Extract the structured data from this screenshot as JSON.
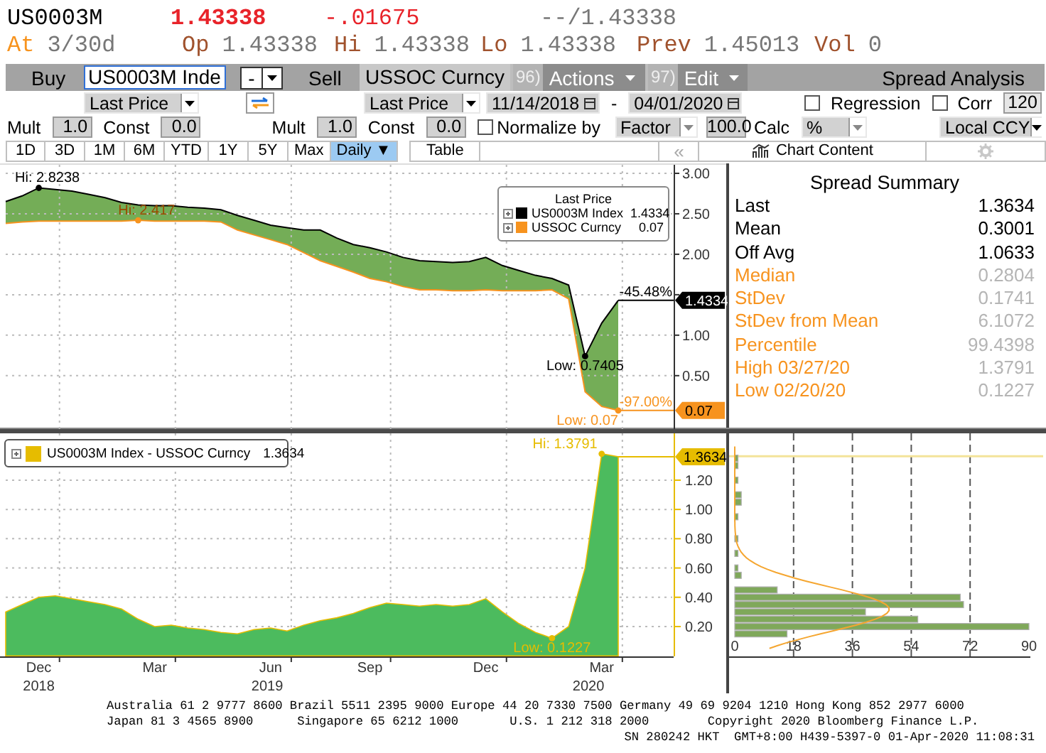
{
  "quote": {
    "ticker": "US0003M",
    "last": "1.43338",
    "change": "-.01675",
    "bid_ask": "--/1.43338"
  },
  "quote_details": [
    {
      "label": "At",
      "value": "3/30d"
    },
    {
      "label": "Op",
      "value": "1.43338"
    },
    {
      "label": "Hi",
      "value": "1.43338"
    },
    {
      "label": "Lo",
      "value": "1.43338"
    },
    {
      "label": "Prev",
      "value": "1.45013"
    },
    {
      "label": "Vol",
      "value": "0"
    }
  ],
  "toolbar": {
    "buy_label": "Buy",
    "buy_security": "US0003M Inde",
    "buy_sign": "-",
    "sell_label": "Sell",
    "sell_security": "USSOC Curncy",
    "menus": [
      {
        "number": "96)",
        "label": "Actions"
      },
      {
        "number": "97)",
        "label": "Edit"
      }
    ],
    "title": "Spread Analysis"
  },
  "fields": {
    "buy_field": "Last Price",
    "sell_field": "Last Price",
    "start_date": "11/14/2018",
    "date_separator": "-",
    "end_date": "04/01/2020",
    "options": [
      {
        "label": "Regression",
        "checked": false
      },
      {
        "label": "Corr",
        "checked": false
      }
    ],
    "corr_window": "120"
  },
  "adjustments": {
    "sides": [
      {
        "mult_label": "Mult",
        "mult": "1.0",
        "const_label": "Const",
        "const": "0.0"
      },
      {
        "mult_label": "Mult",
        "mult": "1.0",
        "const_label": "Const",
        "const": "0.0"
      }
    ],
    "normalize": {
      "label": "Normalize by",
      "checked": false
    },
    "normalize_method": "Factor",
    "normalize_value": "100.0",
    "calc_label": "Calc",
    "calc": "%",
    "currency": "Local CCY"
  },
  "periods": [
    {
      "label": "1D",
      "selected": false
    },
    {
      "label": "3D",
      "selected": false
    },
    {
      "label": "1M",
      "selected": false
    },
    {
      "label": "6M",
      "selected": false
    },
    {
      "label": "YTD",
      "selected": false
    },
    {
      "label": "1Y",
      "selected": false
    },
    {
      "label": "5Y",
      "selected": false
    },
    {
      "label": "Max",
      "selected": false
    },
    {
      "label": "Daily ▼",
      "selected": true
    }
  ],
  "table_button": "Table",
  "collapse_button": "«",
  "chart_content_button": "Chart Content",
  "top_chart": {
    "legend": {
      "title": "Last Price",
      "values": [
        "1.4334",
        "0.07"
      ]
    },
    "value_tags": [
      "1.4334",
      "0.07"
    ],
    "changes": [
      "-45.48%",
      "-97.00%"
    ],
    "chart_data": {
      "type": "line",
      "categories": [
        null,
        null,
        null,
        null,
        null,
        null,
        null,
        null,
        null,
        null,
        null,
        null,
        null,
        null,
        null,
        null,
        null,
        null,
        null,
        null,
        null,
        null,
        null,
        null,
        null,
        null,
        null,
        null,
        null,
        null,
        null,
        null,
        null,
        null,
        null,
        null,
        null,
        null
      ],
      "series": [
        {
          "name": "US0003M Index",
          "color": "#000000",
          "values": [
            2.65,
            2.72,
            2.82,
            2.8,
            2.78,
            2.74,
            2.7,
            2.64,
            2.61,
            2.6,
            2.6,
            2.58,
            2.57,
            2.55,
            2.48,
            2.42,
            2.36,
            2.33,
            2.3,
            2.3,
            2.2,
            2.12,
            2.08,
            2.03,
            1.96,
            1.92,
            1.91,
            1.9,
            1.91,
            1.96,
            1.86,
            1.8,
            1.74,
            1.7,
            1.62,
            0.74,
            1.15,
            1.43
          ]
        },
        {
          "name": "USSOC Curncy",
          "color": "#f7931e",
          "values": [
            2.38,
            2.4,
            2.41,
            2.41,
            2.41,
            2.41,
            2.41,
            2.41,
            2.42,
            2.41,
            2.41,
            2.41,
            2.41,
            2.4,
            2.3,
            2.24,
            2.18,
            2.12,
            2.02,
            1.92,
            1.85,
            1.78,
            1.7,
            1.66,
            1.6,
            1.56,
            1.56,
            1.55,
            1.55,
            1.56,
            1.55,
            1.55,
            1.55,
            1.56,
            1.45,
            0.3,
            0.12,
            0.07
          ]
        }
      ],
      "ylim": [
        -0.16,
        3.1
      ],
      "grid": true,
      "yticks": [
        {
          "value": 0.5,
          "label": "0.50"
        },
        {
          "value": 1,
          "label": "1.00"
        },
        {
          "value": 1.5,
          "label": null
        },
        {
          "value": 2,
          "label": "2.00"
        },
        {
          "value": 2.5,
          "label": "2.50"
        },
        {
          "value": 3,
          "label": "3.00"
        }
      ],
      "annotations": [
        "Hi: 2.8238",
        "Hi: 2.417",
        "Low: 0.7405",
        "Low: 0.07"
      ]
    }
  },
  "summary": {
    "title": "Spread Summary",
    "rows": [
      {
        "kind": "primary",
        "label": "Last",
        "value": "1.3634"
      },
      {
        "kind": "primary",
        "label": "Mean",
        "value": "0.3001"
      },
      {
        "kind": "primary",
        "label": "Off Avg",
        "value": "1.0633"
      },
      {
        "kind": "secondary",
        "label": "Median",
        "value": "0.2804"
      },
      {
        "kind": "secondary",
        "label": "StDev",
        "value": "0.1741"
      },
      {
        "kind": "secondary",
        "label": "StDev from Mean",
        "value": "6.1072"
      },
      {
        "kind": "secondary",
        "label": "Percentile",
        "value": "99.4398"
      },
      {
        "kind": "secondary",
        "label": "High 03/27/20",
        "value": "1.3791"
      },
      {
        "kind": "secondary",
        "label": "Low 02/20/20",
        "value": "0.1227"
      }
    ]
  },
  "bottom_chart": {
    "legend": {
      "values": [
        "1.3634"
      ]
    },
    "value_tags": [
      "1.3634"
    ],
    "year_labels": [
      "2018",
      "2019",
      "2020"
    ],
    "chart_data": {
      "type": "area",
      "categories": [
        null,
        null,
        "Dec",
        null,
        null,
        null,
        null,
        null,
        null,
        "Mar",
        null,
        null,
        null,
        null,
        null,
        null,
        "Jun",
        null,
        null,
        null,
        null,
        null,
        "Sep",
        null,
        null,
        null,
        null,
        null,
        null,
        "Dec",
        null,
        null,
        null,
        null,
        null,
        null,
        "Mar",
        null
      ],
      "series": [
        {
          "name": "US0003M Index - USSOC Curncy",
          "color": "#e6bc00",
          "values": [
            0.3,
            0.35,
            0.4,
            0.41,
            0.39,
            0.37,
            0.35,
            0.32,
            0.25,
            0.2,
            0.21,
            0.19,
            0.18,
            0.16,
            0.15,
            0.18,
            0.19,
            0.17,
            0.21,
            0.24,
            0.26,
            0.29,
            0.33,
            0.36,
            0.35,
            0.34,
            0.35,
            0.34,
            0.35,
            0.39,
            0.3,
            0.22,
            0.16,
            0.12,
            0.2,
            0.6,
            1.38,
            1.36
          ]
        }
      ],
      "ylim": [
        0,
        1.52
      ],
      "grid": true,
      "yticks": [
        {
          "value": 0.2,
          "label": "0.20"
        },
        {
          "value": 0.4,
          "label": "0.40"
        },
        {
          "value": 0.6,
          "label": "0.60"
        },
        {
          "value": 0.8,
          "label": "0.80"
        },
        {
          "value": 1,
          "label": "1.00"
        },
        {
          "value": 1.2,
          "label": "1.20"
        }
      ],
      "annotations": [
        "Hi: 1.3791",
        "Low: 0.1227"
      ]
    }
  },
  "histogram": {
    "chart_data": {
      "type": "bar",
      "orientation": "horizontal",
      "grid": true,
      "x": [
        0.15,
        0.2,
        0.25,
        0.3,
        0.35,
        0.4,
        0.45,
        0.55,
        0.6,
        0.7,
        0.8,
        0.95,
        1.05,
        1.1,
        1.2,
        1.3,
        1.35
      ],
      "values": [
        16,
        90,
        56,
        40,
        70,
        69,
        13,
        2,
        1,
        1,
        1,
        1,
        2,
        2,
        1,
        1,
        1
      ],
      "xlim": [
        0,
        90
      ],
      "ylim": [
        0,
        1.52
      ],
      "xticks": [
        0,
        18,
        36,
        54,
        72,
        90
      ],
      "ref_lines": [
        {
          "axis": "y",
          "value": 1.3634
        }
      ]
    }
  },
  "footer": [
    "Australia 61 2 9777 8600 Brazil 5511 2395 9000 Europe 44 20 7330 7500 Germany 49 69 9204 1210 Hong Kong 852 2977 6000",
    "Japan 81 3 4565 8900      Singapore 65 6212 1000       U.S. 1 212 318 2000        Copyright 2020 Bloomberg Finance L.P.",
    "SN 280242 HKT  GMT+8:00 H439-5397-0 01-Apr-2020 11:08:31"
  ]
}
